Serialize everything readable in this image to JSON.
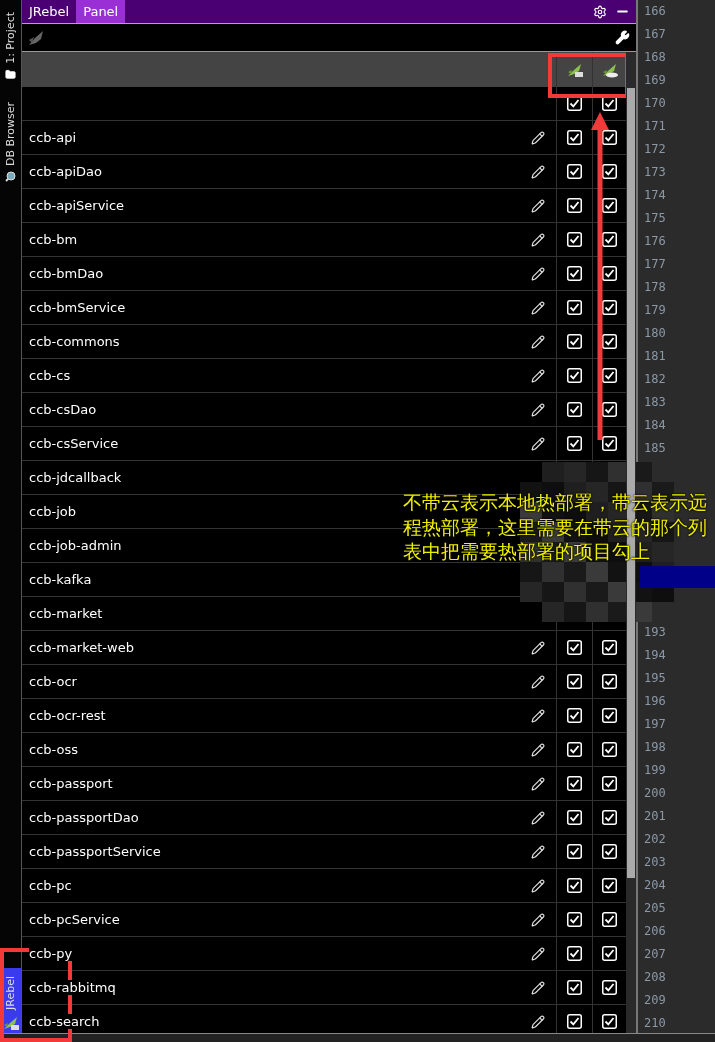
{
  "tool_strip": {
    "top_tabs": [
      {
        "label": "1: Project",
        "selected": false
      },
      {
        "label": "DB Browser",
        "selected": false
      }
    ],
    "bottom_tabs": [
      {
        "label": "JRebel",
        "selected": true
      }
    ]
  },
  "panel": {
    "tabs": [
      {
        "label": "JRebel",
        "selected": false
      },
      {
        "label": "Panel",
        "selected": true
      }
    ]
  },
  "table": {
    "select_all": {
      "local": true,
      "remote": true
    },
    "rows": [
      {
        "name": "ccb-api",
        "editable": true,
        "local": true,
        "remote": true
      },
      {
        "name": "ccb-apiDao",
        "editable": true,
        "local": true,
        "remote": true
      },
      {
        "name": "ccb-apiService",
        "editable": true,
        "local": true,
        "remote": true
      },
      {
        "name": "ccb-bm",
        "editable": true,
        "local": true,
        "remote": true
      },
      {
        "name": "ccb-bmDao",
        "editable": true,
        "local": true,
        "remote": true
      },
      {
        "name": "ccb-bmService",
        "editable": true,
        "local": true,
        "remote": true
      },
      {
        "name": "ccb-commons",
        "editable": true,
        "local": true,
        "remote": true
      },
      {
        "name": "ccb-cs",
        "editable": true,
        "local": true,
        "remote": true
      },
      {
        "name": "ccb-csDao",
        "editable": true,
        "local": true,
        "remote": true
      },
      {
        "name": "ccb-csService",
        "editable": true,
        "local": true,
        "remote": true
      },
      {
        "name": "ccb-jdcallback"
      },
      {
        "name": "ccb-job"
      },
      {
        "name": "ccb-job-admin"
      },
      {
        "name": "ccb-kafka"
      },
      {
        "name": "ccb-market"
      },
      {
        "name": "ccb-market-web",
        "editable": true,
        "local": true,
        "remote": true
      },
      {
        "name": "ccb-ocr",
        "editable": true,
        "local": true,
        "remote": true
      },
      {
        "name": "ccb-ocr-rest",
        "editable": true,
        "local": true,
        "remote": true
      },
      {
        "name": "ccb-oss",
        "editable": true,
        "local": true,
        "remote": true
      },
      {
        "name": "ccb-passport",
        "editable": true,
        "local": true,
        "remote": true
      },
      {
        "name": "ccb-passportDao",
        "editable": true,
        "local": true,
        "remote": true
      },
      {
        "name": "ccb-passportService",
        "editable": true,
        "local": true,
        "remote": true
      },
      {
        "name": "ccb-pc",
        "editable": true,
        "local": true,
        "remote": true
      },
      {
        "name": "ccb-pcService",
        "editable": true,
        "local": true,
        "remote": true
      },
      {
        "name": "ccb-py",
        "editable": true,
        "local": true,
        "remote": true
      },
      {
        "name": "ccb-rabbitmq",
        "editable": true,
        "local": true,
        "remote": true
      },
      {
        "name": "ccb-search",
        "editable": true,
        "local": true,
        "remote": true
      }
    ]
  },
  "gutter": {
    "lines_above": [
      "166",
      "167",
      "168",
      "169",
      "170",
      "171",
      "172",
      "173",
      "174",
      "175",
      "176",
      "177",
      "178",
      "179",
      "180",
      "181",
      "182",
      "183",
      "184",
      "185"
    ],
    "lines_below": [
      "193",
      "194",
      "195",
      "196",
      "197",
      "198",
      "199",
      "200",
      "201",
      "202",
      "203",
      "204",
      "205",
      "206",
      "207",
      "208",
      "209",
      "210"
    ]
  },
  "annotation": {
    "text": "不带云表示本地热部署，带云表示远程热部署，这里需要在带云的那个列表中把需要热部署的项目勾上"
  }
}
